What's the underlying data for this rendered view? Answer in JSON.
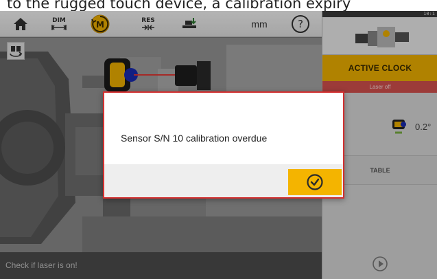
{
  "caption": {
    "text": "to the rugged touch device, a calibration expiry"
  },
  "toolbar": {
    "home_icon": "home-icon",
    "dim_label": "DIM",
    "measure_icon": "measure-mode-icon",
    "measure_label": "M",
    "res_label": "RES",
    "align_icon": "alignment-icon",
    "units_label": "mm",
    "help_icon": "help-icon",
    "help_label": "?",
    "accent_color": "#f4b400"
  },
  "sidebar_left": {
    "machine_icon": "machine-rotate-icon"
  },
  "right_panel": {
    "status_time": "10:1",
    "active_clock_label": "ACTIVE CLOCK",
    "laser_status": "Laser off",
    "angle_value": "0.2°",
    "table_label": "TABLE",
    "play_icon": "play-icon",
    "laser_status_color": "#d9534f"
  },
  "main": {
    "status_message": "Check if laser is on!"
  },
  "dialog": {
    "message": "Sensor S/N 10 calibration overdue",
    "confirm_icon": "checkmark-circle-icon",
    "border_color": "#d32f2f"
  }
}
